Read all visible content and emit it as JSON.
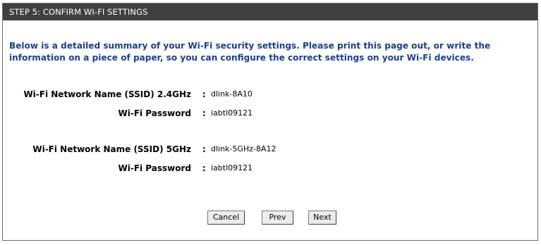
{
  "header": {
    "title": "STEP 5: CONFIRM WI-FI SETTINGS"
  },
  "intro": {
    "line1": "Below is a detailed summary of your Wi-Fi security settings. Please print this page out, or write the",
    "line2": "information on a piece of paper, so you can configure the correct settings on your Wi-Fi devices."
  },
  "settings": {
    "ssid_24_label": "Wi-Fi Network Name (SSID) 2.4GHz",
    "ssid_24_value": "dlink-8A10",
    "password_24_label": "Wi-Fi Password",
    "password_24_value": "iabtl09121",
    "ssid_5_label": "Wi-Fi Network Name (SSID) 5GHz",
    "ssid_5_value": "dlink-5GHz-8A12",
    "password_5_label": "Wi-Fi Password",
    "password_5_value": "iabtl09121",
    "separator": ":"
  },
  "buttons": {
    "cancel": "Cancel",
    "prev": "Prev",
    "next": "Next"
  },
  "colors": {
    "header_bg": "#404040",
    "intro_text": "#1a3f8c",
    "border": "#6e6e6e"
  }
}
